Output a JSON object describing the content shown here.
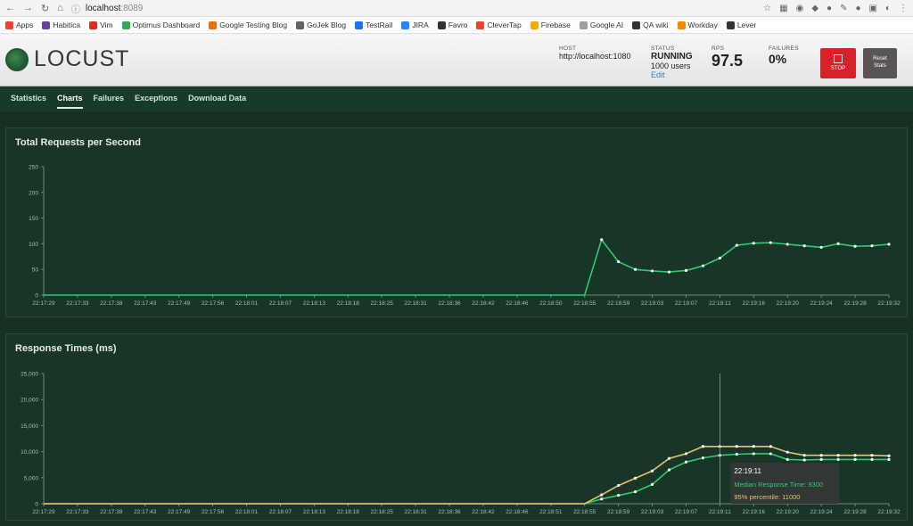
{
  "browser": {
    "url_host": "localhost",
    "url_port": ":8089",
    "bookmarks": [
      {
        "label": "Apps",
        "color": "#e94235"
      },
      {
        "label": "Habitica",
        "color": "#6b3fa0"
      },
      {
        "label": "Vim",
        "color": "#d93025"
      },
      {
        "label": "Optimus Dashboard",
        "color": "#34a853"
      },
      {
        "label": "Google Testing Blog",
        "color": "#e8710a"
      },
      {
        "label": "GoJek Blog",
        "color": "#5f6368"
      },
      {
        "label": "TestRail",
        "color": "#1a73e8"
      },
      {
        "label": "JIRA",
        "color": "#2684ff"
      },
      {
        "label": "Favro",
        "color": "#333333"
      },
      {
        "label": "CleverTap",
        "color": "#e94235"
      },
      {
        "label": "Firebase",
        "color": "#f9ab00"
      },
      {
        "label": "Google AI",
        "color": "#9aa0a6"
      },
      {
        "label": "QA wiki",
        "color": "#333333"
      },
      {
        "label": "Workday",
        "color": "#f38b00"
      },
      {
        "label": "Lever",
        "color": "#333333"
      }
    ]
  },
  "header": {
    "brand": "LOCUST",
    "host_label": "HOST",
    "host_value": "http://localhost:1080",
    "status_label": "STATUS",
    "status_value": "RUNNING",
    "users_value": "1000 users",
    "edit_label": "Edit",
    "rps_label": "RPS",
    "rps_value": "97.5",
    "failures_label": "FAILURES",
    "failures_value": "0%",
    "stop_label": "STOP",
    "reset_label_1": "Reset",
    "reset_label_2": "Stats"
  },
  "tabs": [
    {
      "label": "Statistics"
    },
    {
      "label": "Charts",
      "active": true
    },
    {
      "label": "Failures"
    },
    {
      "label": "Exceptions"
    },
    {
      "label": "Download Data"
    }
  ],
  "chart_data": [
    {
      "type": "line",
      "title": "Total Requests per Second",
      "ylim": [
        0,
        250
      ],
      "yticks": [
        "0",
        "50",
        "100",
        "150",
        "200",
        "250"
      ],
      "xticks": [
        "22:17:29",
        "22:17:33",
        "22:17:38",
        "22:17:43",
        "22:17:49",
        "22:17:56",
        "22:18:01",
        "22:18:07",
        "22:18:13",
        "22:18:18",
        "22:18:25",
        "22:18:31",
        "22:18:36",
        "22:18:42",
        "22:18:46",
        "22:18:50",
        "22:18:55",
        "22:18:59",
        "22:19:03",
        "22:19:07",
        "22:19:11",
        "22:19:16",
        "22:19:20",
        "22:19:24",
        "22:19:28",
        "22:19:32"
      ],
      "series": [
        {
          "color": "#2ecc71",
          "points": [
            [
              0,
              0
            ],
            [
              16,
              0
            ],
            [
              16.5,
              108
            ],
            [
              17,
              65
            ],
            [
              17.5,
              50
            ],
            [
              18,
              47
            ],
            [
              18.5,
              45
            ],
            [
              19,
              48
            ],
            [
              19.5,
              57
            ],
            [
              20,
              72
            ],
            [
              20.5,
              97
            ],
            [
              21,
              101
            ],
            [
              21.5,
              102
            ],
            [
              22,
              99
            ],
            [
              22.5,
              96
            ],
            [
              23,
              93
            ],
            [
              23.5,
              100
            ],
            [
              24,
              95
            ],
            [
              24.5,
              96
            ],
            [
              25,
              99
            ]
          ]
        }
      ]
    },
    {
      "type": "line",
      "title": "Response Times (ms)",
      "ylim": [
        0,
        25000
      ],
      "yticks": [
        "0",
        "5,000",
        "10,000",
        "15,000",
        "20,000",
        "25,000"
      ],
      "xticks": [
        "22:17:29",
        "22:17:33",
        "22:17:38",
        "22:17:43",
        "22:17:49",
        "22:17:56",
        "22:18:01",
        "22:18:07",
        "22:18:13",
        "22:18:18",
        "22:18:25",
        "22:18:31",
        "22:18:36",
        "22:18:42",
        "22:18:46",
        "22:18:51",
        "22:18:55",
        "22:18:59",
        "22:19:03",
        "22:19:07",
        "22:19:11",
        "22:19:16",
        "22:19:20",
        "22:19:24",
        "22:19:28",
        "22:19:32"
      ],
      "series": [
        {
          "name": "Median Response Time",
          "color": "#2ecc71",
          "points": [
            [
              0,
              0
            ],
            [
              16,
              0
            ],
            [
              16.5,
              900
            ],
            [
              17,
              1600
            ],
            [
              17.5,
              2300
            ],
            [
              18,
              3700
            ],
            [
              18.5,
              6500
            ],
            [
              19,
              8000
            ],
            [
              19.5,
              8800
            ],
            [
              20,
              9300
            ],
            [
              20.5,
              9500
            ],
            [
              21,
              9600
            ],
            [
              21.5,
              9600
            ],
            [
              22,
              8500
            ],
            [
              22.5,
              8400
            ],
            [
              23,
              8500
            ],
            [
              23.5,
              8500
            ],
            [
              24,
              8500
            ],
            [
              24.5,
              8500
            ],
            [
              25,
              8500
            ]
          ]
        },
        {
          "name": "95% percentile",
          "color": "#e8c26a",
          "points": [
            [
              0,
              0
            ],
            [
              16,
              0
            ],
            [
              16.5,
              1700
            ],
            [
              17,
              3500
            ],
            [
              17.5,
              4900
            ],
            [
              18,
              6300
            ],
            [
              18.5,
              8700
            ],
            [
              19,
              9600
            ],
            [
              19.5,
              11000
            ],
            [
              20,
              11000
            ],
            [
              20.5,
              11000
            ],
            [
              21,
              11000
            ],
            [
              21.5,
              11000
            ],
            [
              22,
              9900
            ],
            [
              22.5,
              9300
            ],
            [
              23,
              9300
            ],
            [
              23.5,
              9300
            ],
            [
              24,
              9300
            ],
            [
              24.5,
              9300
            ],
            [
              25,
              9200
            ]
          ]
        }
      ],
      "tooltip": {
        "time": "22:19:11",
        "median_label": "Median Response Time: 9300",
        "p95_label": "95% percentile: 11000"
      }
    }
  ]
}
